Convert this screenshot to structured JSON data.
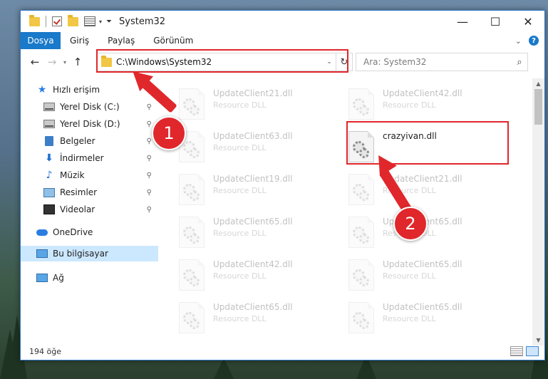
{
  "window": {
    "title": "System32"
  },
  "ribbon": {
    "tabs": [
      "Dosya",
      "Giriş",
      "Paylaş",
      "Görünüm"
    ],
    "help": "?"
  },
  "controls": {
    "minimize": "—",
    "maximize": "☐",
    "close": "✕"
  },
  "nav": {
    "back": "←",
    "forward": "→",
    "up": "↑",
    "recent": "▾",
    "address": "C:\\Windows\\System32",
    "address_drop": "⌄",
    "refresh": "↻",
    "search_placeholder": "Ara: System32"
  },
  "sidebar": {
    "items": [
      {
        "label": "Hızlı erişim",
        "icon": "star-icon"
      },
      {
        "label": "Yerel Disk (C:)",
        "icon": "drive-icon",
        "pinned": true
      },
      {
        "label": "Yerel Disk (D:)",
        "icon": "drive-icon",
        "pinned": true
      },
      {
        "label": "Belgeler",
        "icon": "documents-icon",
        "pinned": true
      },
      {
        "label": "İndirmeler",
        "icon": "download-icon",
        "pinned": true
      },
      {
        "label": "Müzik",
        "icon": "music-icon",
        "pinned": true
      },
      {
        "label": "Resimler",
        "icon": "pictures-icon",
        "pinned": true
      },
      {
        "label": "Videolar",
        "icon": "videos-icon",
        "pinned": true
      },
      {
        "label": "OneDrive",
        "icon": "cloud-icon"
      },
      {
        "label": "Bu bilgisayar",
        "icon": "computer-icon",
        "selected": true
      },
      {
        "label": "Ağ",
        "icon": "network-icon"
      }
    ],
    "pin_glyph": "📌"
  },
  "files": {
    "left": [
      {
        "name": "UpdateClient21.dll",
        "type": "Resource DLL"
      },
      {
        "name": "UpdateClient63.dll",
        "type": "Resource DLL"
      },
      {
        "name": "UpdateClient19.dll",
        "type": "Resource DLL"
      },
      {
        "name": "UpdateClient65.dll",
        "type": "Resource DLL"
      },
      {
        "name": "UpdateClient42.dll",
        "type": "Resource DLL"
      },
      {
        "name": "UpdateClient65.dll",
        "type": "Resource DLL"
      }
    ],
    "right": [
      {
        "name": "UpdateClient42.dll",
        "type": "Resource DLL"
      },
      {
        "name": "crazyivan.dll",
        "type": "",
        "highlighted": true
      },
      {
        "name": "UpdateClient21.dll",
        "type": "Resource DLL"
      },
      {
        "name": "UpdateClient65.dll",
        "type": "Resource DLL"
      },
      {
        "name": "UpdateClient65.dll",
        "type": "Resource DLL"
      },
      {
        "name": "UpdateClient65.dll",
        "type": "Resource DLL"
      }
    ]
  },
  "status": {
    "count": "194 öğe"
  },
  "callouts": {
    "one": "1",
    "two": "2"
  },
  "colors": {
    "accent": "#1979ca",
    "callout": "#e0272b",
    "selected": "#cce8ff"
  }
}
